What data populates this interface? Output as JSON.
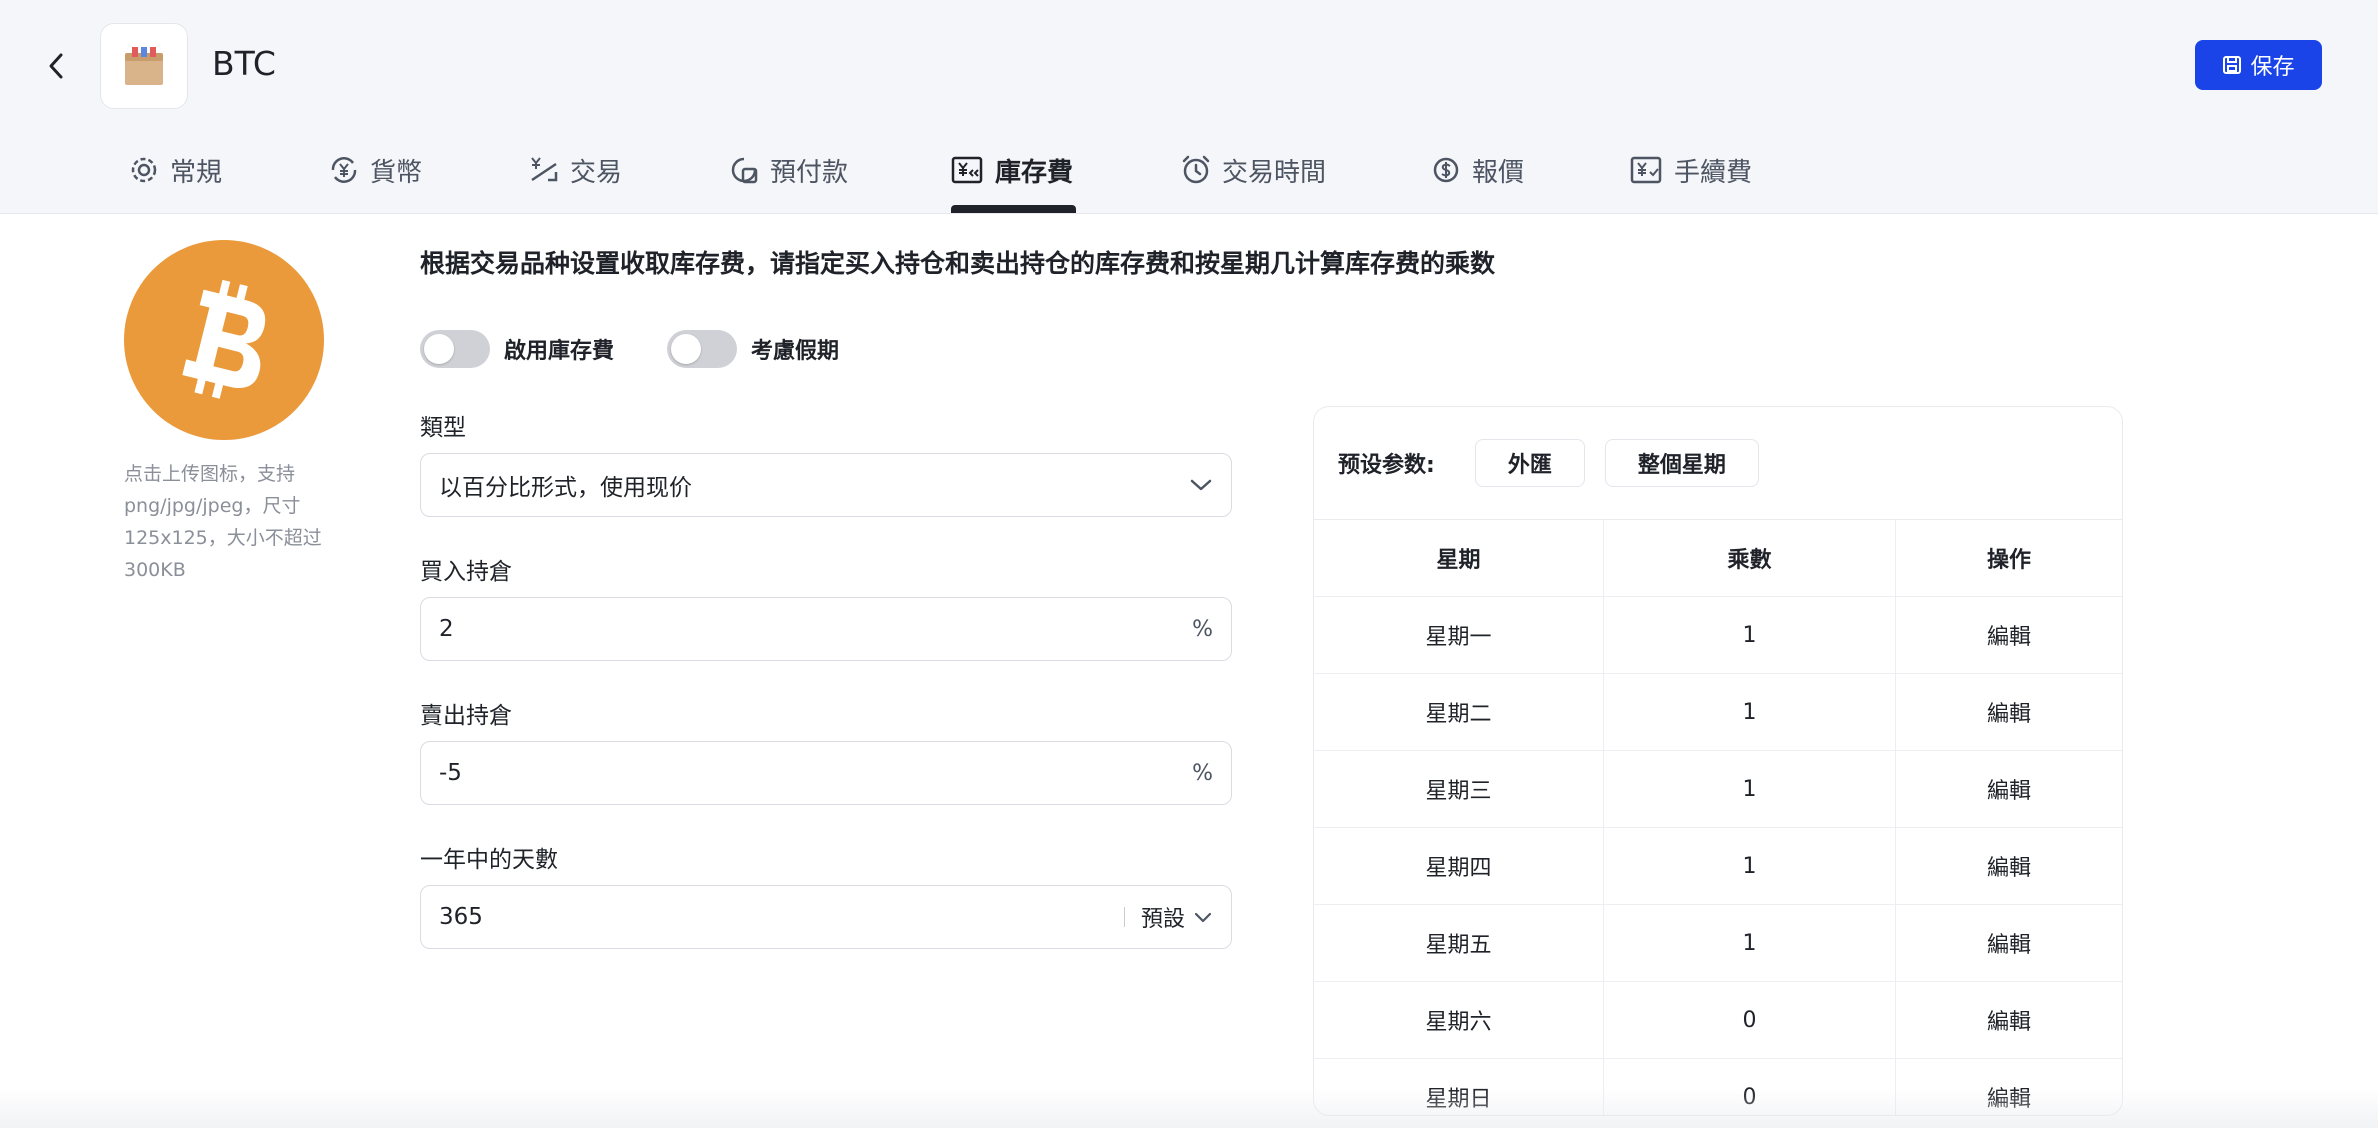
{
  "header": {
    "title": "BTC",
    "save_label": "保存"
  },
  "tabs": [
    {
      "label": "常規",
      "icon": "gear-icon"
    },
    {
      "label": "貨幣",
      "icon": "currency-exchange-icon"
    },
    {
      "label": "交易",
      "icon": "trade-icon"
    },
    {
      "label": "預付款",
      "icon": "prepayment-icon"
    },
    {
      "label": "庫存費",
      "icon": "swap-fee-icon",
      "active": true
    },
    {
      "label": "交易時間",
      "icon": "clock-icon"
    },
    {
      "label": "報價",
      "icon": "quote-icon"
    },
    {
      "label": "手續費",
      "icon": "commission-icon"
    }
  ],
  "avatar": {
    "upload_hint": "点击上传图标，支持png/jpg/jpeg，尺寸125x125，大小不超过300KB",
    "icon": "bitcoin-icon"
  },
  "description": "根据交易品种设置收取库存费，请指定买入持仓和卖出持仓的库存费和按星期几计算库存费的乘数",
  "toggles": [
    {
      "label": "啟用庫存費",
      "on": false
    },
    {
      "label": "考慮假期",
      "on": false
    }
  ],
  "form": {
    "type": {
      "label": "類型",
      "value": "以百分比形式，使用现价"
    },
    "buy": {
      "label": "買入持倉",
      "value": "2",
      "suffix": "%"
    },
    "sell": {
      "label": "賣出持倉",
      "value": "-5",
      "suffix": "%"
    },
    "days": {
      "label": "一年中的天數",
      "value": "365",
      "preset": "預設"
    }
  },
  "panel": {
    "preset_label": "预设参数:",
    "presets": [
      "外匯",
      "整個星期"
    ],
    "columns": [
      "星期",
      "乘數",
      "操作"
    ],
    "rows": [
      {
        "day": "星期一",
        "multiplier": "1",
        "action": "編輯"
      },
      {
        "day": "星期二",
        "multiplier": "1",
        "action": "編輯"
      },
      {
        "day": "星期三",
        "multiplier": "1",
        "action": "編輯"
      },
      {
        "day": "星期四",
        "multiplier": "1",
        "action": "編輯"
      },
      {
        "day": "星期五",
        "multiplier": "1",
        "action": "編輯"
      },
      {
        "day": "星期六",
        "multiplier": "0",
        "action": "編輯"
      },
      {
        "day": "星期日",
        "multiplier": "0",
        "action": "編輯"
      }
    ]
  },
  "colors": {
    "accent": "#1a44e8",
    "bitcoin": "#ea9a3b",
    "header_bg": "#f5f6fa"
  }
}
